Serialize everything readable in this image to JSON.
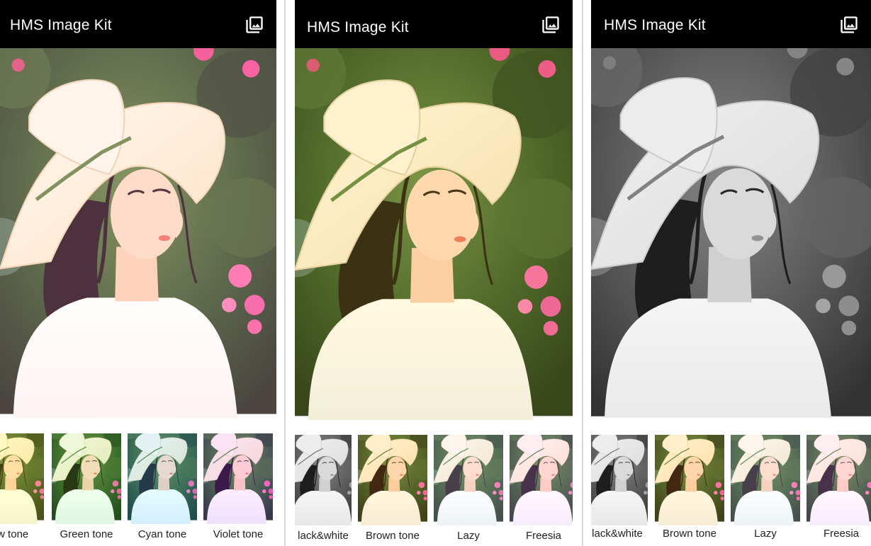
{
  "screens": [
    {
      "app_title": "HMS Image Kit",
      "filters": [
        "ow tone",
        "Green tone",
        "Cyan tone",
        "Violet tone"
      ]
    },
    {
      "app_title": "HMS Image Kit",
      "filters": [
        "lack&white",
        "Brown tone",
        "Lazy",
        "Freesia"
      ]
    },
    {
      "app_title": "HMS Image Kit",
      "filters": [
        "lack&white",
        "Brown tone",
        "Lazy",
        "Freesia"
      ]
    }
  ],
  "icons": {
    "gallery": "photo-library-icon"
  },
  "colors": {
    "appbar": "#000000",
    "background": "#ffffff",
    "label": "#222222"
  }
}
